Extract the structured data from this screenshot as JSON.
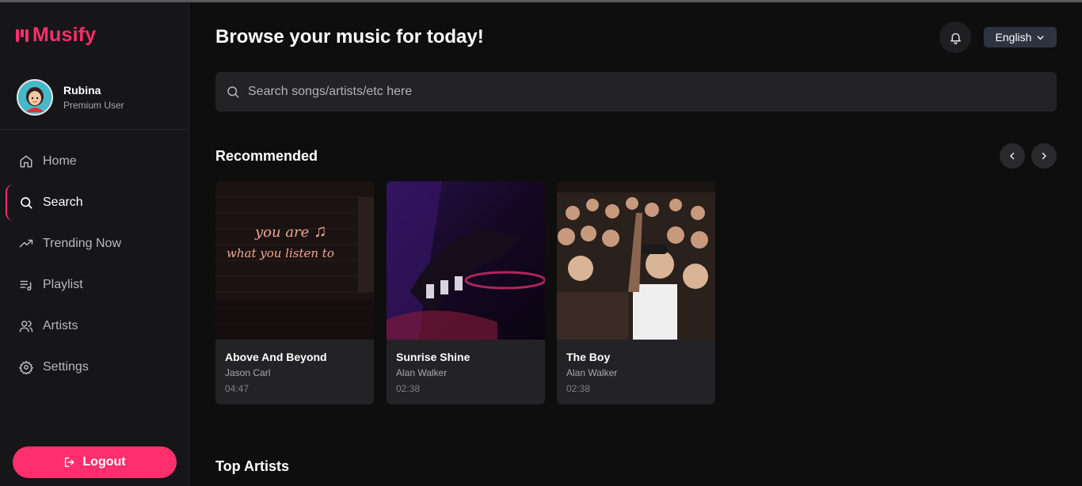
{
  "brand": {
    "name": "Musify",
    "accent": "#ff2e6d"
  },
  "user": {
    "name": "Rubina",
    "role": "Premium User"
  },
  "nav": [
    {
      "label": "Home",
      "icon": "home-icon",
      "active": false
    },
    {
      "label": "Search",
      "icon": "search-icon",
      "active": true
    },
    {
      "label": "Trending Now",
      "icon": "trending-icon",
      "active": false
    },
    {
      "label": "Playlist",
      "icon": "playlist-icon",
      "active": false
    },
    {
      "label": "Artists",
      "icon": "artists-icon",
      "active": false
    },
    {
      "label": "Settings",
      "icon": "settings-icon",
      "active": false
    }
  ],
  "logout_label": "Logout",
  "header": {
    "title": "Browse your music for today!",
    "language": "English"
  },
  "search": {
    "placeholder": "Search songs/artists/etc here"
  },
  "recommended": {
    "title": "Recommended",
    "cards": [
      {
        "title": "Above And Beyond",
        "artist": "Jason Carl",
        "duration": "04:47",
        "neon_line1": "you are",
        "neon_line2": "what you listen to"
      },
      {
        "title": "Sunrise Shine",
        "artist": "Alan Walker",
        "duration": "02:38"
      },
      {
        "title": "The Boy",
        "artist": "Alan Walker",
        "duration": "02:38"
      }
    ]
  },
  "top_artists": {
    "title": "Top Artists"
  }
}
